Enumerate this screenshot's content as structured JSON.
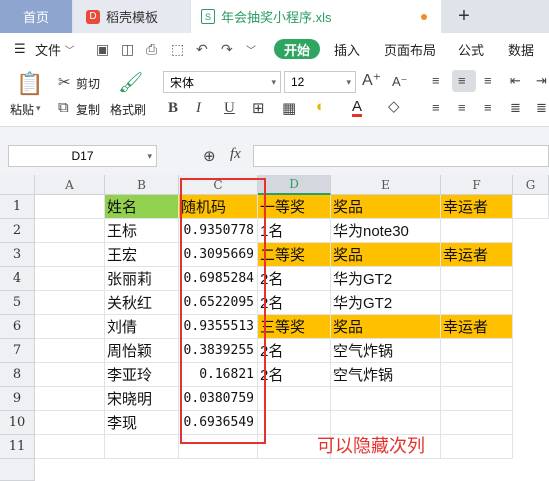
{
  "tabs": {
    "home": "首页",
    "template": "稻壳模板",
    "file": "年会抽奖小程序.xls",
    "new_tab": "+"
  },
  "menu": {
    "file": "文件",
    "start": "开始",
    "insert": "插入",
    "page_layout": "页面布局",
    "formula": "公式",
    "data": "数据"
  },
  "ribbon": {
    "paste": "粘贴",
    "cut": "剪切",
    "copy": "复制",
    "format_painter": "格式刷",
    "font_name": "宋体",
    "font_size": "12",
    "bold": "B",
    "italic": "I",
    "underline": "U"
  },
  "formula_bar": {
    "name_box": "D17",
    "fx": "fx",
    "value": ""
  },
  "columns": [
    "A",
    "B",
    "C",
    "D",
    "E",
    "F",
    "G"
  ],
  "rows": [
    "1",
    "2",
    "3",
    "4",
    "5",
    "6",
    "7",
    "8",
    "9",
    "10",
    "11"
  ],
  "cells": {
    "B1": "姓名",
    "C1": "随机码",
    "D1": "一等奖",
    "E1": "奖品",
    "F1": "幸运者",
    "B2": "王标",
    "C2": "0.9350778",
    "D2": "1名",
    "E2": "华为note30",
    "B3": "王宏",
    "C3": "0.3095669",
    "D3": "二等奖",
    "E3": "奖品",
    "F3": "幸运者",
    "B4": "张丽莉",
    "C4": "0.6985284",
    "D4": "2名",
    "E4": "华为GT2",
    "B5": "关秋红",
    "C5": "0.6522095",
    "D5": "2名",
    "E5": "华为GT2",
    "B6": "刘倩",
    "C6": "0.9355513",
    "D6": "三等奖",
    "E6": "奖品",
    "F6": "幸运者",
    "B7": "周怡颖",
    "C7": "0.3839255",
    "D7": "2名",
    "E7": "空气炸锅",
    "B8": "李亚玲",
    "C8": "0.16821",
    "D8": "2名",
    "E8": "空气炸锅",
    "B9": "宋晓明",
    "C9": "0.0380759",
    "B10": "李现",
    "C10": "0.6936549"
  },
  "annotation": "可以隐藏次列",
  "colors": {
    "accent_green": "#2fa562",
    "orange": "#ffc000",
    "header_green": "#92d050",
    "highlight_red": "#e5322d"
  }
}
